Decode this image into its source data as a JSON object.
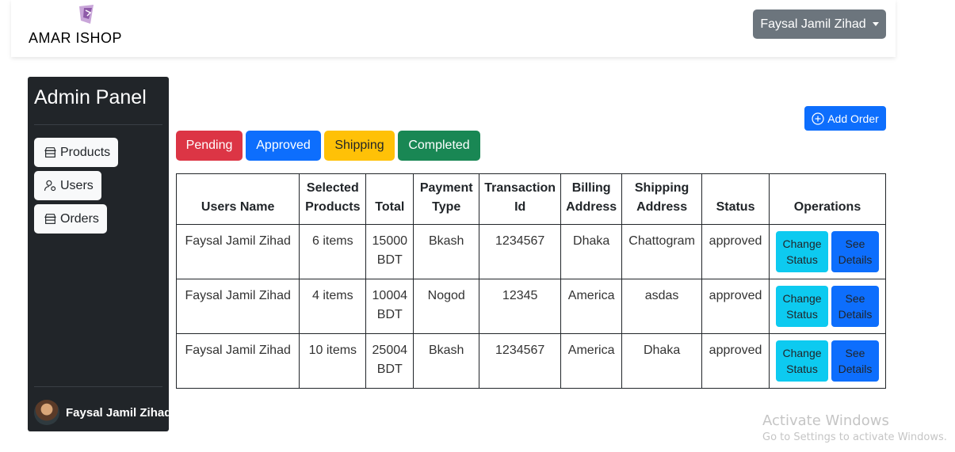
{
  "brand": {
    "name": "AMAR ISHOP"
  },
  "navbar": {
    "user_menu_label": "Faysal Jamil Zihad"
  },
  "sidebar": {
    "title": "Admin Panel",
    "items": [
      {
        "label": "Products",
        "icon": "store-icon"
      },
      {
        "label": "Users",
        "icon": "user-gear-icon"
      },
      {
        "label": "Orders",
        "icon": "store-icon"
      }
    ],
    "user_name": "Faysal Jamil Zihad"
  },
  "main": {
    "add_order_label": "Add Order",
    "status_filters": [
      {
        "label": "Pending",
        "color": "#dc3545"
      },
      {
        "label": "Approved",
        "color": "#0d6efd"
      },
      {
        "label": "Shipping",
        "color": "#ffc107"
      },
      {
        "label": "Completed",
        "color": "#198754"
      }
    ],
    "table": {
      "headers": [
        "Users Name",
        "Selected Products",
        "Total",
        "Payment Type",
        "Transaction Id",
        "Billing Address",
        "Shipping Address",
        "Status",
        "Operations"
      ],
      "rows": [
        {
          "user": "Faysal Jamil Zihad",
          "products": "6 items",
          "total": "15000 BDT",
          "payment": "Bkash",
          "transaction": "1234567",
          "billing": "Dhaka",
          "shipping": "Chattogram",
          "status": "approved"
        },
        {
          "user": "Faysal Jamil Zihad",
          "products": "4 items",
          "total": "10004 BDT",
          "payment": "Nogod",
          "transaction": "12345",
          "billing": "America",
          "shipping": "asdas",
          "status": "approved"
        },
        {
          "user": "Faysal Jamil Zihad",
          "products": "10 items",
          "total": "25004 BDT",
          "payment": "Bkash",
          "transaction": "1234567",
          "billing": "America",
          "shipping": "Dhaka",
          "status": "approved"
        }
      ],
      "change_status_label": "Change Status",
      "see_details_label": "See Details"
    }
  },
  "watermark": {
    "line1": "Activate Windows",
    "line2": "Go to Settings to activate Windows."
  }
}
